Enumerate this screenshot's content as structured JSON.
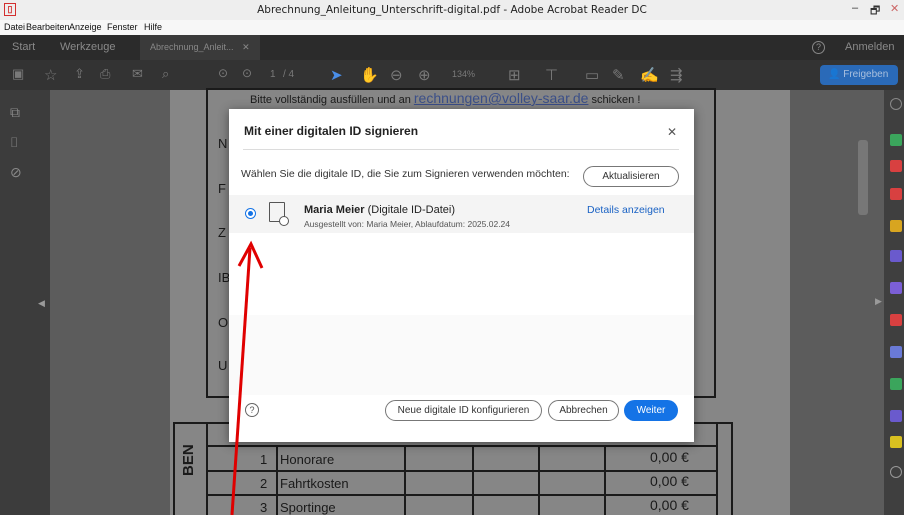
{
  "window": {
    "title": "Abrechnung_Anleitung_Unterschrift-digital.pdf - Adobe Acrobat Reader DC",
    "minimize": "–",
    "maximize": "🗗",
    "close": "✕"
  },
  "menu": [
    "Datei",
    "Bearbeiten",
    "Anzeige",
    "Fenster",
    "Hilfe"
  ],
  "tabs": {
    "start": "Start",
    "tools": "Werkzeuge",
    "document": "Abrechnung_Anleit...",
    "document_close": "✕",
    "help_icon": "?",
    "login": "Anmelden"
  },
  "toolbar": {
    "page_current": "1",
    "page_total": "/ 4",
    "zoom": "134%",
    "share": "Freigeben"
  },
  "document": {
    "instruction_prefix": "Bitte vollständig ausfüllen und an ",
    "email": "rechnungen@volley-saar.de",
    "instruction_suffix": " schicken !",
    "field_letters": [
      "N",
      "F",
      "Z",
      "IB",
      "O",
      "U"
    ],
    "side_label": "BEN",
    "rows": [
      {
        "num": "1",
        "label": "Honorare",
        "value": "0,00 €"
      },
      {
        "num": "2",
        "label": "Fahrtkosten",
        "value": "0,00 €"
      },
      {
        "num": "3",
        "label": "Sportinge",
        "value": "0,00 €"
      }
    ]
  },
  "dialog": {
    "title": "Mit einer digitalen ID signieren",
    "close": "✕",
    "prompt": "Wählen Sie die digitale ID, die Sie zum Signieren verwenden möchten:",
    "refresh_button": "Aktualisieren",
    "ids": [
      {
        "name": "Maria Meier",
        "type": "(Digitale ID-Datei)",
        "issued": "Ausgestellt von: Maria Meier, Ablaufdatum: 2025.02.24",
        "details_link": "Details anzeigen",
        "selected": true
      }
    ],
    "help": "?",
    "configure_button": "Neue digitale ID konfigurieren",
    "cancel_button": "Abbrechen",
    "continue_button": "Weiter"
  },
  "colors": {
    "accent": "#1473e6",
    "annotation": "#e00000"
  }
}
